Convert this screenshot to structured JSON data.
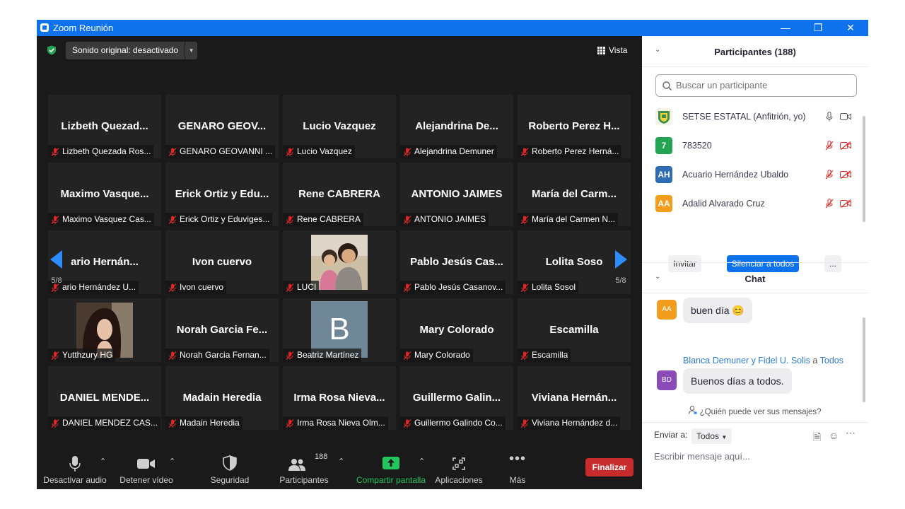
{
  "window": {
    "title": "Zoom Reunión"
  },
  "meeting": {
    "sound_label": "Sonido original: desactivado",
    "view_label": "Vista",
    "page_indicator": "5/8",
    "tiles": [
      {
        "big": "Lizbeth  Quezad...",
        "name": "Lizbeth Quezada Ros..."
      },
      {
        "big": "GENARO GEOV...",
        "name": "GENARO GEOVANNI ..."
      },
      {
        "big": "Lucio Vazquez",
        "name": "Lucio Vazquez"
      },
      {
        "big": "Alejandrina  De...",
        "name": "Alejandrina Demuner"
      },
      {
        "big": "Roberto Perez H...",
        "name": "Roberto Perez Herná..."
      },
      {
        "big": "Maximo  Vasque...",
        "name": "Maximo Vasquez Cas..."
      },
      {
        "big": "Erick Ortiz y Edu...",
        "name": "Erick Ortiz y Eduviges..."
      },
      {
        "big": "Rene CABRERA",
        "name": "Rene CABRERA"
      },
      {
        "big": "ANTONIO JAIMES",
        "name": "ANTONIO JAIMES"
      },
      {
        "big": "María del Carm...",
        "name": "María del Carmen N..."
      },
      {
        "big": "ario  Hernán...",
        "name": "ario Hernández U..."
      },
      {
        "big": "Ivon cuervo",
        "name": "Ivon cuervo"
      },
      {
        "big": "",
        "name": "LUCI"
      },
      {
        "big": "Pablo Jesús Cas...",
        "name": "Pablo Jesús Casanov..."
      },
      {
        "big": "Lolita Soso",
        "name": "Lolita Sosol"
      },
      {
        "big": "",
        "name": "Yutthzury HG"
      },
      {
        "big": "Norah Garcia Fe...",
        "name": "Norah Garcia Fernan..."
      },
      {
        "big": "",
        "name": "Beatriz Martínez",
        "avatar_letter": "B"
      },
      {
        "big": "Mary Colorado",
        "name": "Mary Colorado"
      },
      {
        "big": "Escamilla",
        "name": "Escamilla"
      },
      {
        "big": "DANIEL  MENDE...",
        "name": "DANIEL MENDEZ CAS..."
      },
      {
        "big": "Madain Heredia",
        "name": "Madain Heredia"
      },
      {
        "big": "Irma Rosa Nieva...",
        "name": "Irma Rosa Nieva Olm..."
      },
      {
        "big": "Guillermo  Galin...",
        "name": "Guillermo Galindo Co..."
      },
      {
        "big": "Viviana  Hernán...",
        "name": "Viviana Hernández d..."
      }
    ]
  },
  "toolbar": {
    "audio": "Desactivar audio",
    "video": "Detener vídeo",
    "security": "Seguridad",
    "participants": "Participantes",
    "participants_count": "188",
    "share": "Compartir pantalla",
    "apps": "Aplicaciones",
    "more": "Más",
    "end": "Finalizar"
  },
  "participants_panel": {
    "title": "Participantes (188)",
    "search_placeholder": "Buscar un participante",
    "list": [
      {
        "initials": "",
        "name": "SETSE ESTATAL (Anfitrión, yo)",
        "color": "#e8e8d0"
      },
      {
        "initials": "7",
        "name": "783520",
        "color": "#23a455"
      },
      {
        "initials": "AH",
        "name": "Acuario Hernández Ubaldo",
        "color": "#2e6db4"
      },
      {
        "initials": "AA",
        "name": "Adalid Alvarado Cruz",
        "color": "#f29d1e"
      }
    ],
    "invite": "Invitar",
    "mute_all": "Silenciar a todos",
    "more": "..."
  },
  "chat": {
    "title": "Chat",
    "messages": [
      {
        "avatar": "AA",
        "text": "buen día",
        "emoji": "😊",
        "color": "#f29d1e"
      },
      {
        "avatar": "BD",
        "text": "Buenos días a todos.",
        "color": "#8a4bb8"
      }
    ],
    "sender_line": {
      "from": "Blanca Demuner y Fidel U. Solis",
      "to_word": "a",
      "to": "Todos"
    },
    "who_can_see": "¿Quién puede ver sus mensajes?",
    "send_to_label": "Enviar a:",
    "send_to_value": "Todos",
    "composer_placeholder": "Escribir mensaje aquí..."
  },
  "colors": {
    "accent": "#0e72ed",
    "end": "#c72b2b",
    "share": "#23c55e",
    "muted": "#e02828"
  }
}
